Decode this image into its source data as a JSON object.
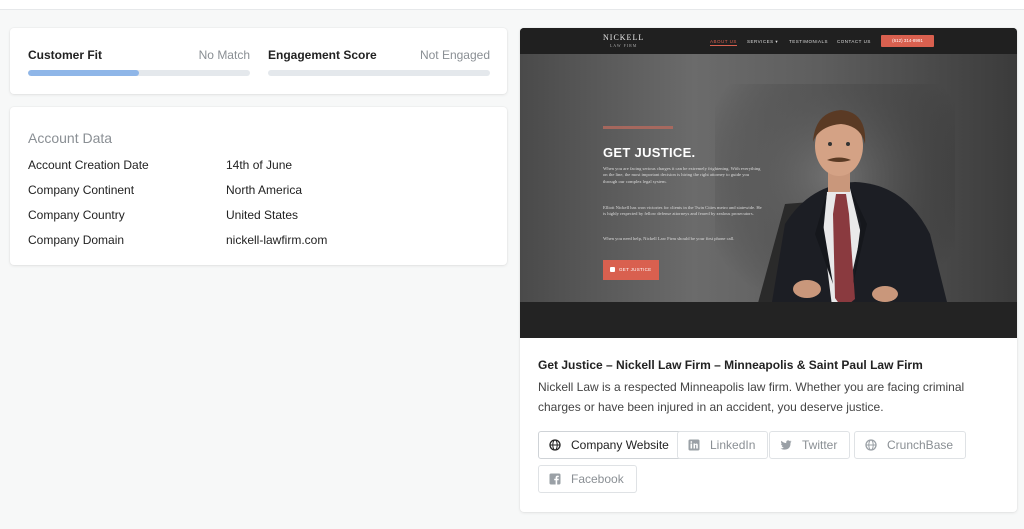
{
  "scores": {
    "customer_fit": {
      "label": "Customer Fit",
      "status": "No Match",
      "progress": 0.5
    },
    "engagement": {
      "label": "Engagement Score",
      "status": "Not Engaged",
      "progress": 0
    }
  },
  "account": {
    "title": "Account Data",
    "rows": [
      {
        "key": "Account Creation Date",
        "value": "14th of June"
      },
      {
        "key": "Company Continent",
        "value": "North America"
      },
      {
        "key": "Company Country",
        "value": "United States"
      },
      {
        "key": "Company Domain",
        "value": "nickell-lawfirm.com"
      }
    ]
  },
  "preview": {
    "site": {
      "logo": "NICKELL",
      "logo_sub": "LAW FIRM",
      "nav": [
        "ABOUT US",
        "SERVICES ▾",
        "TESTIMONIALS",
        "CONTACT US"
      ],
      "phone": "(612) 314-8991",
      "hero_title": "GET JUSTICE.",
      "hero_paragraphs": [
        "When you are facing serious charges it can be extremely frightening. With everything on the line, the most important decision is hiring the right attorney to guide you through our complex legal system.",
        "Elliott Nickell has won victories for clients in the Twin Cities metro and statewide. He is highly respected by fellow defense attorneys and feared by zealous prosecutors.",
        "When you need help, Nickell Law Firm should be your first phone call."
      ],
      "hero_button": "GET JUSTICE"
    },
    "title": "Get Justice – Nickell Law Firm – Minneapolis & Saint Paul Law Firm",
    "description": "Nickell Law is a respected Minneapolis law firm. Whether you are facing criminal charges or have been injured in an accident, you deserve justice.",
    "links": {
      "website": "Company Website",
      "linkedin": "LinkedIn",
      "twitter": "Twitter",
      "crunchbase": "CrunchBase",
      "facebook": "Facebook"
    }
  },
  "colors": {
    "progress_fill": "#8fb6e8",
    "progress_track": "#e4e8ec",
    "site_accent": "#d9604f"
  }
}
